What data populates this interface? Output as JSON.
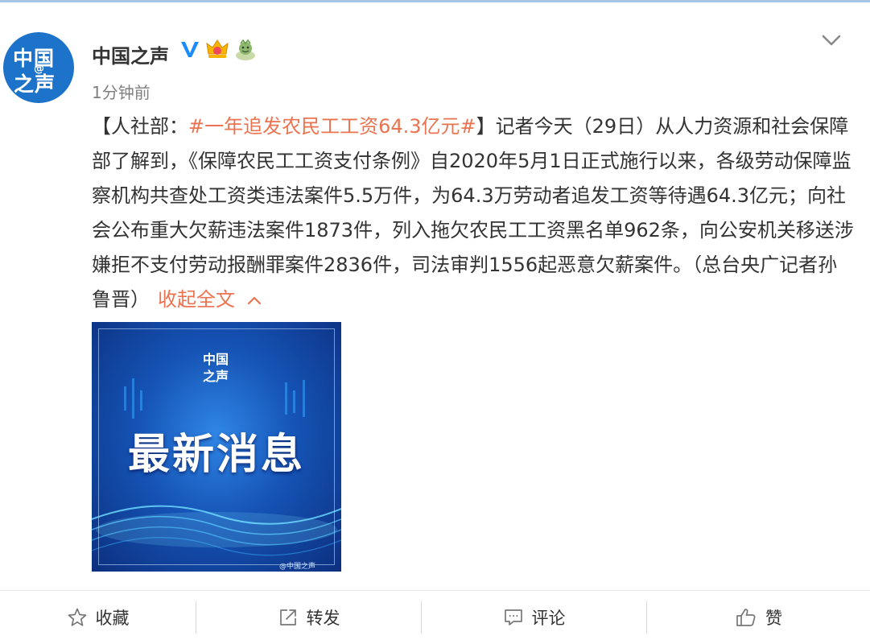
{
  "account": {
    "name": "中国之声",
    "avatar_line1": "中国",
    "avatar_line2": "之声",
    "avatar_at": "@"
  },
  "post": {
    "time": "1分钟前",
    "prefix": "【人社部：",
    "topic": "#一年追发农民工工资64.3亿元#",
    "body": "】记者今天（29日）从人力资源和社会保障部了解到，《保障农民工工资支付条例》自2020年5月1日正式施行以来，各级劳动保障监察机构共查处工资类违法案件5.5万件，为64.3万劳动者追发工资等待遇64.3亿元；向社会公布重大欠薪违法案件1873件，列入拖欠农民工工资黑名单962条，向公安机关移送涉嫌拒不支付劳动报酬罪案件2836件，司法审判1556起恶意欠薪案件。（总台央广记者孙鲁晋）",
    "collapse_label": "收起全文"
  },
  "image": {
    "logo_line1": "中国",
    "logo_line2": "之声",
    "heading": "最新消息",
    "watermark": "@中国之声"
  },
  "actions": {
    "favorite": "收藏",
    "repost": "转发",
    "comment": "评论",
    "like": "赞"
  },
  "colors": {
    "accent": "#eb7350",
    "verified": "#1a8cff",
    "avatar_bg": "#1d73c9"
  },
  "icons": [
    "verified-icon",
    "crown-icon",
    "emoji-badge-icon",
    "chevron-down-icon",
    "chevron-up-icon",
    "star-icon",
    "repost-icon",
    "comment-icon",
    "thumb-up-icon"
  ]
}
